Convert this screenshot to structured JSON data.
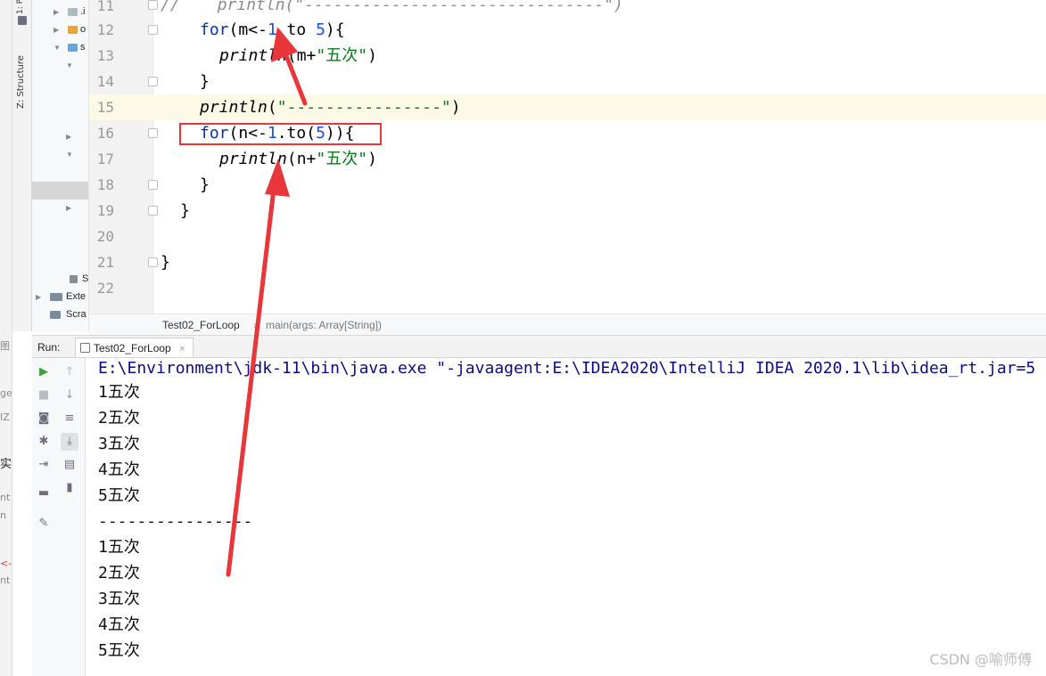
{
  "left_slice": {
    "fragments": [
      "图",
      "ge",
      "IZ",
      "实",
      "nt",
      "n",
      "<-",
      "nt"
    ]
  },
  "tool_strip": {
    "tab_project": "1: P",
    "tab_structure": "Z: Structure"
  },
  "project_tree": {
    "rows": [
      {
        "label": ".i"
      },
      {
        "label": "o"
      },
      {
        "label": "s"
      },
      {
        "label": ""
      },
      {
        "label": ""
      },
      {
        "label": ""
      },
      {
        "label": "S"
      },
      {
        "label": "Exte"
      },
      {
        "label": "Scra"
      }
    ]
  },
  "editor": {
    "line_numbers": [
      "11",
      "12",
      "13",
      "14",
      "15",
      "16",
      "17",
      "18",
      "19",
      "20",
      "21",
      "22"
    ],
    "current_line": "15",
    "code": {
      "l11_comment": "//",
      "l11_text": "println(\"-------------------------------\")",
      "l12_kw": "for",
      "l12_a": "(m<-",
      "l12_n1": "1",
      "l12_to": " to ",
      "l12_n2": "5",
      "l12_b": "){",
      "l13_fn": "println",
      "l13_a": "(m+",
      "l13_str": "\"五次\"",
      "l13_b": ")",
      "l14": "}",
      "l15_fn": "println",
      "l15_a": "(",
      "l15_str": "\"----------------\"",
      "l15_b": ")",
      "l16_kw": "for",
      "l16_a": "(n<-",
      "l16_n1": "1",
      "l16_b": ".to(",
      "l16_n2": "5",
      "l16_c": ")){",
      "l17_fn": "println",
      "l17_a": "(n+",
      "l17_str": "\"五次\"",
      "l17_b": ")",
      "l18": "}",
      "l19": "}",
      "l21": "}"
    }
  },
  "breadcrumb": {
    "object": "Test02_ForLoop",
    "separator": "›",
    "method": "main(args: Array[String])"
  },
  "run_panel": {
    "label": "Run:",
    "tab_label": "Test02_ForLoop",
    "tab_close": "×"
  },
  "console": {
    "command": "E:\\Environment\\jdk-11\\bin\\java.exe \"-javaagent:E:\\IDEA2020\\IntelliJ IDEA 2020.1\\lib\\idea_rt.jar=5",
    "lines": [
      "1五次",
      "2五次",
      "3五次",
      "4五次",
      "5五次",
      "----------------",
      "1五次",
      "2五次",
      "3五次",
      "4五次",
      "5五次"
    ]
  },
  "colors": {
    "keyword": "#0033b3",
    "number": "#1750eb",
    "string": "#067d17",
    "annotation_red": "#e8363a"
  },
  "watermark": "CSDN @喻师傅"
}
